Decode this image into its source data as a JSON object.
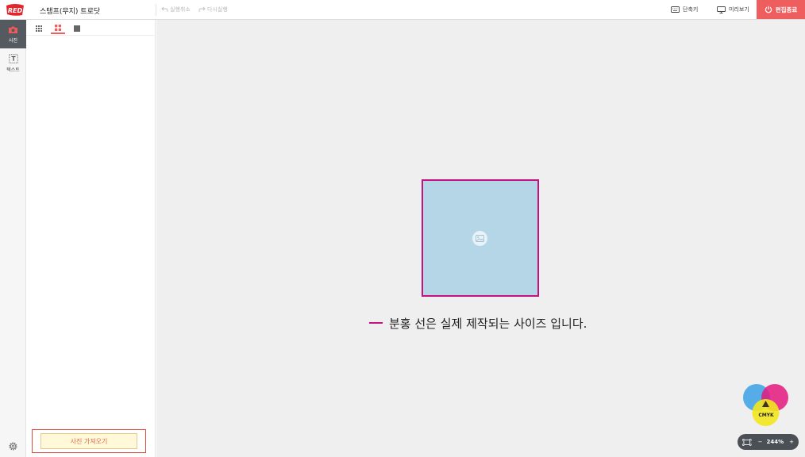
{
  "app": {
    "logo_text": "RED",
    "document_title": "스탬프(무지) 트로닷"
  },
  "toolbar": {
    "undo_label": "실행취소",
    "redo_label": "다시실행",
    "shortcut_label": "단축키",
    "preview_label": "미리보기",
    "finish_label": "편집종료"
  },
  "rail": {
    "items": [
      {
        "label": "사진",
        "icon": "camera-icon",
        "active": true
      },
      {
        "label": "텍스트",
        "icon": "text-box-icon",
        "active": false
      }
    ],
    "settings_icon": "gear-icon"
  },
  "panel": {
    "view_tabs": [
      {
        "icon": "grid-small-icon",
        "active": false
      },
      {
        "icon": "grid-large-icon",
        "active": true
      },
      {
        "icon": "single-square-icon",
        "active": false
      }
    ],
    "import_button_label": "사진 가져오기"
  },
  "canvas": {
    "notice_text": "분홍 선은 실제 제작되는 사이즈 입니다.",
    "cmyk_label": "CMYK",
    "zoom_level": "244%"
  },
  "colors": {
    "accent": "#ef5e5e",
    "trim_line": "#c8107e",
    "artboard_fill": "#b4d6e6",
    "rail_active": "#555a61",
    "canvas_bg": "#efefef"
  }
}
